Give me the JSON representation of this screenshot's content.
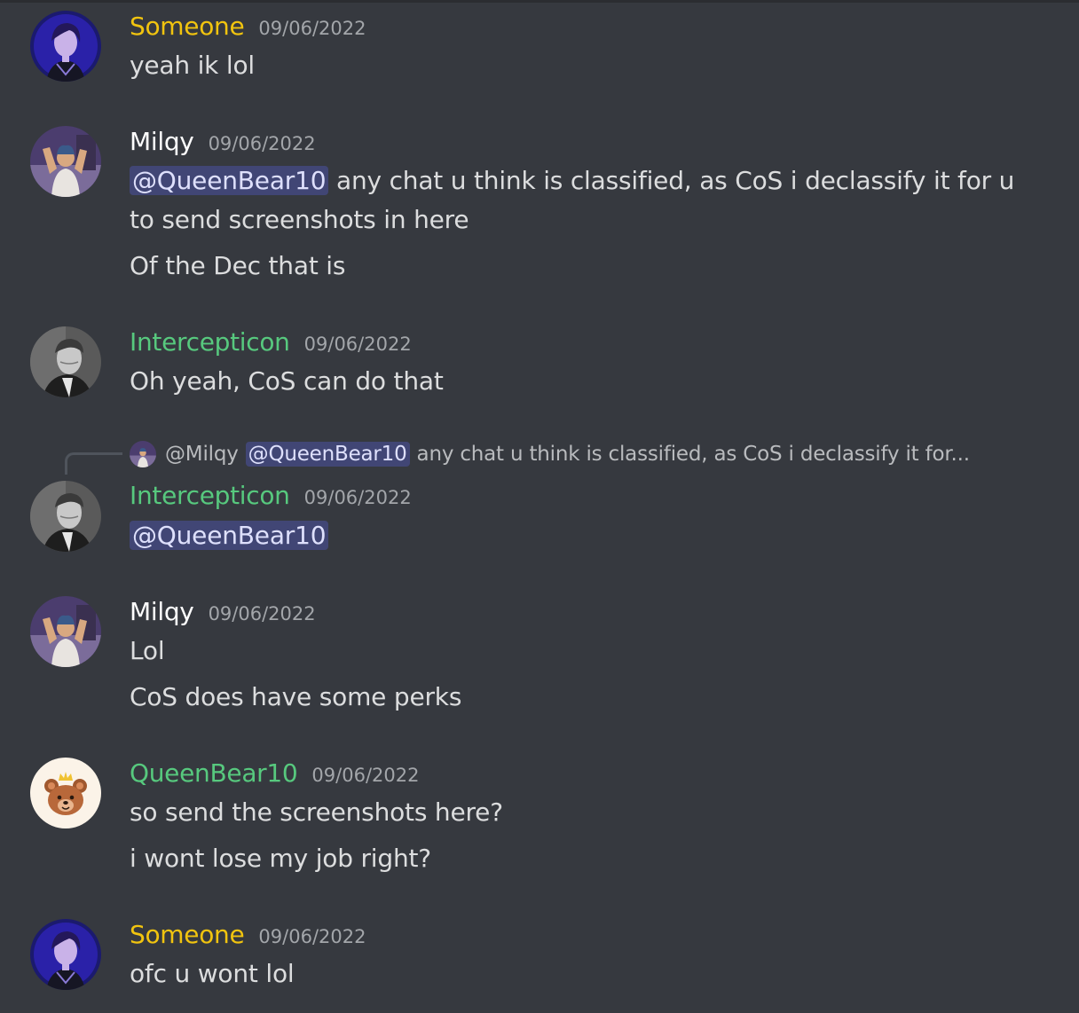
{
  "colors": {
    "background": "#36393f",
    "username_yellow": "#f1c40f",
    "username_white": "#ffffff",
    "username_green": "#57c97e",
    "mention_bg": "#414675",
    "mention_text": "#dee0fc",
    "timestamp": "#a3a6aa"
  },
  "messages": [
    {
      "username": "Someone",
      "timestamp": "09/06/2022",
      "lines": [
        "yeah ik lol"
      ]
    },
    {
      "username": "Milqy",
      "timestamp": "09/06/2022",
      "mention": "@QueenBear10",
      "lines": [
        "any chat u think is classified, as CoS i declassify it for u",
        "to send screenshots in here",
        "Of the Dec that is"
      ]
    },
    {
      "username": "Intercepticon",
      "timestamp": "09/06/2022",
      "lines": [
        "Oh yeah, CoS can do that"
      ]
    },
    {
      "reply": {
        "author": "@Milqy",
        "mention": "@QueenBear10",
        "preview": "any chat u think is classified, as CoS i declassify it for..."
      },
      "username": "Intercepticon",
      "timestamp": "09/06/2022",
      "mention": "@QueenBear10"
    },
    {
      "username": "Milqy",
      "timestamp": "09/06/2022",
      "lines": [
        "Lol",
        "CoS does have some perks"
      ]
    },
    {
      "username": "QueenBear10",
      "timestamp": "09/06/2022",
      "lines": [
        "so send the screenshots here?",
        "i wont lose my job right?"
      ]
    },
    {
      "username": "Someone",
      "timestamp": "09/06/2022",
      "lines": [
        "ofc u wont lol"
      ]
    }
  ],
  "icons": {
    "someone_avatar": "anime-character-avatar-icon",
    "milqy_avatar": "person-photo-avatar-icon",
    "intercepticon_avatar": "grayscale-portrait-avatar-icon",
    "queenbear_avatar": "crowned-bear-avatar-icon"
  }
}
